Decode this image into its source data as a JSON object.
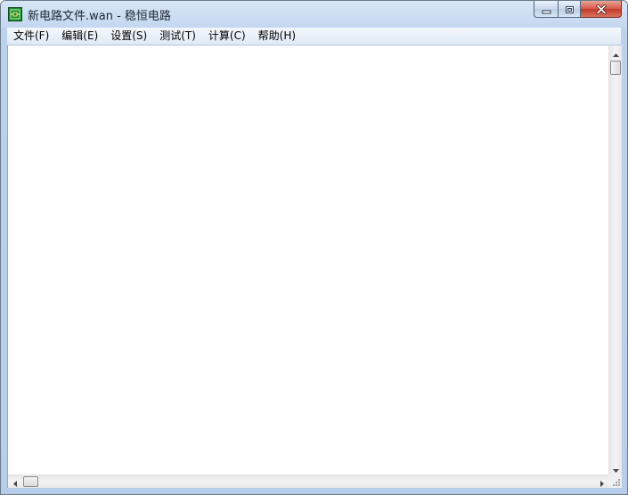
{
  "window": {
    "title": "新电路文件.wan - 稳恒电路",
    "icon": "circuit-app-icon"
  },
  "caption_buttons": {
    "minimize_icon": "minimize-icon",
    "maximize_icon": "restore-icon",
    "close_icon": "close-icon"
  },
  "menubar": {
    "items": [
      {
        "label": "文件(F)"
      },
      {
        "label": "编辑(E)"
      },
      {
        "label": "设置(S)"
      },
      {
        "label": "测试(T)"
      },
      {
        "label": "计算(C)"
      },
      {
        "label": "帮助(H)"
      }
    ]
  },
  "scrollbars": {
    "vertical": {
      "position": 0.0
    },
    "horizontal": {
      "position": 0.0
    }
  },
  "colors": {
    "titlebar": "#c3d7ef",
    "close_button": "#c33a2b",
    "content_bg": "#ffffff"
  }
}
